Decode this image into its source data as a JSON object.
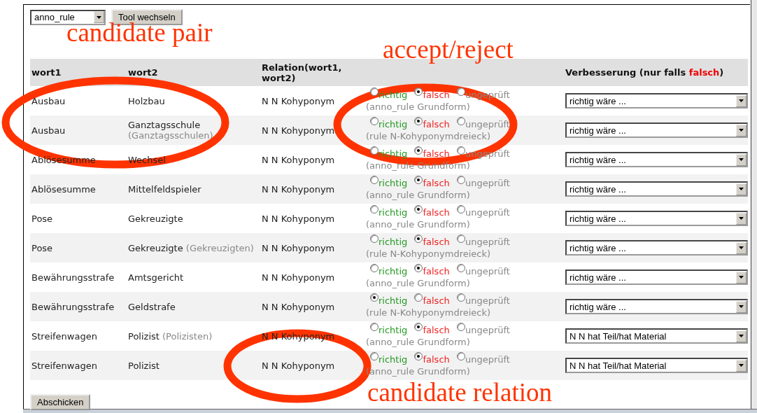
{
  "toolbar": {
    "tool_select": "anno_rule",
    "switch_button": "Tool wechseln"
  },
  "table": {
    "columns": [
      {
        "label": "wort1"
      },
      {
        "label": "wort2"
      },
      {
        "label": "Relation(wort1, wort2)"
      },
      {},
      {
        "label": "Verbesserung (nur falls ",
        "highlight": "falsch",
        "suffix": ")"
      }
    ],
    "rows": [
      {
        "wort1": "Ausbau",
        "wort2": "Holzbau",
        "relation": "N N Kohyponym",
        "options": [
          {
            "kind": "right",
            "label": "richtig",
            "selected": false
          },
          {
            "kind": "wrong",
            "label": "falsch",
            "selected": true
          },
          {
            "kind": "unchecked",
            "label": "ungeprüft",
            "selected": false
          }
        ],
        "source": "(anno_rule Grundform)",
        "correction": "richtig wäre ..."
      },
      {
        "wort1": "Ausbau",
        "wort2": "Ganztagsschule",
        "wort2_base": "(Ganztagsschulen)",
        "relation": "N N Kohyponym",
        "options": [
          {
            "kind": "right",
            "label": "richtig",
            "selected": false
          },
          {
            "kind": "wrong",
            "label": "falsch",
            "selected": true
          },
          {
            "kind": "unchecked",
            "label": "ungeprüft",
            "selected": false
          }
        ],
        "source": "(rule N-Kohyponymdreieck)",
        "correction": "richtig wäre ..."
      },
      {
        "wort1": "Ablösesumme",
        "wort2": "Wechsel",
        "relation": "N N Kohyponym",
        "options": [
          {
            "kind": "right",
            "label": "richtig",
            "selected": false
          },
          {
            "kind": "wrong",
            "label": "falsch",
            "selected": true
          },
          {
            "kind": "unchecked",
            "label": "ungeprüft",
            "selected": false
          }
        ],
        "source": "(anno_rule Grundform)",
        "correction": "richtig wäre ..."
      },
      {
        "wort1": "Ablösesumme",
        "wort2": "Mittelfeldspieler",
        "relation": "N N Kohyponym",
        "options": [
          {
            "kind": "right",
            "label": "richtig",
            "selected": false
          },
          {
            "kind": "wrong",
            "label": "falsch",
            "selected": true
          },
          {
            "kind": "unchecked",
            "label": "ungeprüft",
            "selected": false
          }
        ],
        "source": "(anno_rule Grundform)",
        "correction": "richtig wäre ..."
      },
      {
        "wort1": "Pose",
        "wort2": "Gekreuzigte",
        "relation": "N N Kohyponym",
        "options": [
          {
            "kind": "right",
            "label": "richtig",
            "selected": false
          },
          {
            "kind": "wrong",
            "label": "falsch",
            "selected": true
          },
          {
            "kind": "unchecked",
            "label": "ungeprüft",
            "selected": false
          }
        ],
        "source": "(anno_rule Grundform)",
        "correction": "richtig wäre ..."
      },
      {
        "wort1": "Pose",
        "wort2": "Gekreuzigte",
        "wort2_base": "(Gekreuzigten)",
        "relation": "N N Kohyponym",
        "options": [
          {
            "kind": "right",
            "label": "richtig",
            "selected": false
          },
          {
            "kind": "wrong",
            "label": "falsch",
            "selected": true
          },
          {
            "kind": "unchecked",
            "label": "ungeprüft",
            "selected": false
          }
        ],
        "source": "(rule N-Kohyponymdreieck)",
        "correction": "richtig wäre ..."
      },
      {
        "wort1": "Bewährungsstrafe",
        "wort2": "Amtsgericht",
        "relation": "N N Kohyponym",
        "options": [
          {
            "kind": "right",
            "label": "richtig",
            "selected": false
          },
          {
            "kind": "wrong",
            "label": "falsch",
            "selected": true
          },
          {
            "kind": "unchecked",
            "label": "ungeprüft",
            "selected": false
          }
        ],
        "source": "(anno_rule Grundform)",
        "correction": "richtig wäre ..."
      },
      {
        "wort1": "Bewährungsstrafe",
        "wort2": "Geldstrafe",
        "relation": "N N Kohyponym",
        "options": [
          {
            "kind": "right",
            "label": "richtig",
            "selected": true
          },
          {
            "kind": "wrong",
            "label": "falsch",
            "selected": false
          },
          {
            "kind": "unchecked",
            "label": "ungeprüft",
            "selected": false
          }
        ],
        "source": "(rule N-Kohyponymdreieck)",
        "correction": "richtig wäre ..."
      },
      {
        "wort1": "Streifenwagen",
        "wort2": "Polizist",
        "wort2_base": "(Polizisten)",
        "relation": "N N Kohyponym",
        "options": [
          {
            "kind": "right",
            "label": "richtig",
            "selected": false
          },
          {
            "kind": "wrong",
            "label": "falsch",
            "selected": true
          },
          {
            "kind": "unchecked",
            "label": "ungeprüft",
            "selected": false
          }
        ],
        "source": "(anno_rule Grundform)",
        "correction": "N N hat Teil/hat Material"
      },
      {
        "wort1": "Streifenwagen",
        "wort2": "Polizist",
        "relation": "N N Kohyponym",
        "options": [
          {
            "kind": "right",
            "label": "richtig",
            "selected": false
          },
          {
            "kind": "wrong",
            "label": "falsch",
            "selected": true
          },
          {
            "kind": "unchecked",
            "label": "ungeprüft",
            "selected": false
          }
        ],
        "source": "(anno_rule Grundform)",
        "correction": "N N hat Teil/hat Material"
      }
    ]
  },
  "submit_button": "Abschicken",
  "annotations": [
    "candidate pair",
    "accept/reject",
    "candidate relation"
  ]
}
